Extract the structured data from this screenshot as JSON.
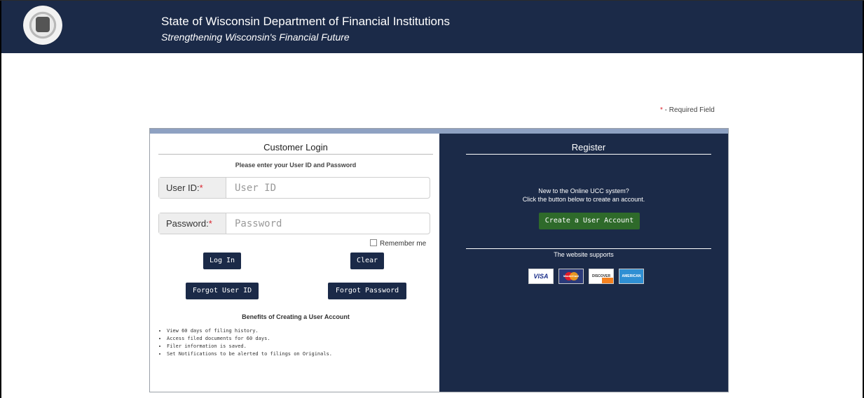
{
  "header": {
    "title": "State of Wisconsin Department of Financial Institutions",
    "subtitle": "Strengthening Wisconsin's Financial Future",
    "seal_icon": "wisconsin-seal-icon",
    "background_color": "#1b2a48"
  },
  "required_note": {
    "star": "*",
    "text": " - Required Field"
  },
  "login": {
    "title": "Customer Login",
    "instructions": "Please enter your User ID and Password",
    "user_id": {
      "label": "User ID:",
      "star": "*",
      "placeholder": "User ID",
      "value": ""
    },
    "password": {
      "label": "Password:",
      "star": "*",
      "placeholder": "Password",
      "value": ""
    },
    "remember_label": "Remember me",
    "remember_checked": false,
    "login_button": "Log In",
    "clear_button": "Clear",
    "forgot_user_button": "Forgot User ID",
    "forgot_password_button": "Forgot Password",
    "benefits_title": "Benefits of Creating a User Account",
    "benefits": [
      "View 60 days of filing history.",
      "Access filed documents for 60 days.",
      "Filer information is saved.",
      "Set Notifications to be alerted to filings on Originals."
    ]
  },
  "register": {
    "title": "Register",
    "line1": "New to the Online UCC system?",
    "line2": "Click the button below to create an account.",
    "create_button": "Create a User Account",
    "supports_text": "The website supports",
    "cards": {
      "visa": "VISA",
      "mastercard": "MasterCard",
      "discover": "DISCOVER",
      "amex": "AMERICAN EXPRESS"
    }
  },
  "colors": {
    "navy": "#1b2a48",
    "green_button": "#2e6a2a",
    "required_star": "#d9232d"
  }
}
